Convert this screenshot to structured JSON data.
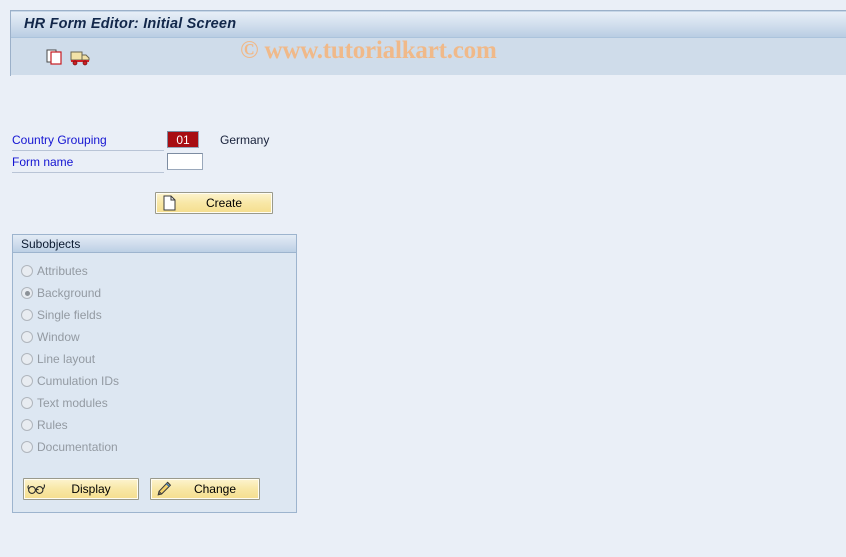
{
  "window": {
    "title": "HR Form Editor: Initial Screen"
  },
  "toolbar": {
    "items": [
      {
        "name": "copy-icon",
        "tooltip": "Copy"
      },
      {
        "name": "truck-icon",
        "tooltip": "Transport"
      }
    ]
  },
  "watermark": {
    "text": "© www.tutorialkart.com",
    "color": "#f0b989"
  },
  "form": {
    "fields": [
      {
        "label": "Country Grouping",
        "value": "01",
        "placeholder": "",
        "description": "Germany",
        "key_field": true
      },
      {
        "label": "Form name",
        "value": "",
        "placeholder": "",
        "description": "",
        "key_field": false
      }
    ],
    "create_label": "Create"
  },
  "subobjects": {
    "title": "Subobjects",
    "options": [
      {
        "label": "Attributes",
        "selected": false
      },
      {
        "label": "Background",
        "selected": true
      },
      {
        "label": "Single fields",
        "selected": false
      },
      {
        "label": "Window",
        "selected": false
      },
      {
        "label": "Line layout",
        "selected": false
      },
      {
        "label": "Cumulation IDs",
        "selected": false
      },
      {
        "label": "Text modules",
        "selected": false
      },
      {
        "label": "Rules",
        "selected": false
      },
      {
        "label": "Documentation",
        "selected": false
      }
    ],
    "display_label": "Display",
    "change_label": "Change"
  },
  "colors": {
    "page_background": "#eaeff7",
    "title_bar": "#cfdcea",
    "key_field_background": "#a80d12",
    "label_text": "#1414d2",
    "button_face": "#f5de8e",
    "panel_background": "#dde7f2"
  }
}
